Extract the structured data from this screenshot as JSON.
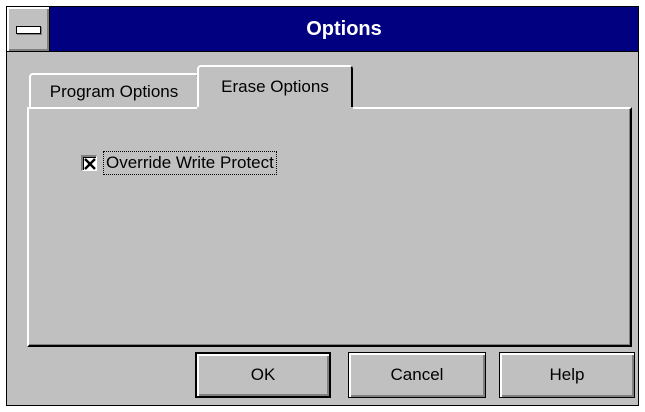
{
  "window": {
    "title": "Options"
  },
  "tabs": [
    {
      "label": "Program Options",
      "selected": false
    },
    {
      "label": "Erase Options",
      "selected": true
    }
  ],
  "erase_options": {
    "override_write_protect": {
      "label": "Override Write Protect",
      "checked": true
    }
  },
  "buttons": {
    "ok": "OK",
    "cancel": "Cancel",
    "help": "Help"
  }
}
